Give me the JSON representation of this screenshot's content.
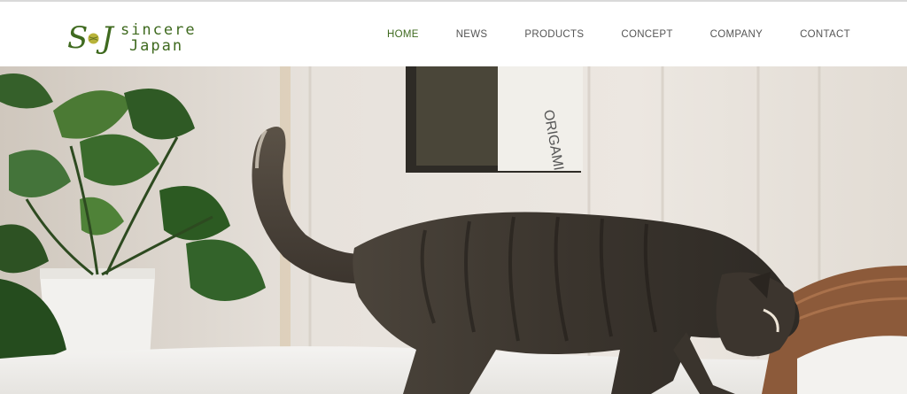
{
  "brand": {
    "mark_left": "S",
    "mark_right": "J",
    "word1": "sincere",
    "word2": "Japan",
    "color": "#3f6a1f"
  },
  "nav": {
    "items": [
      {
        "label": "HOME",
        "active": true
      },
      {
        "label": "NEWS",
        "active": false
      },
      {
        "label": "PRODUCTS",
        "active": false
      },
      {
        "label": "CONCEPT",
        "active": false
      },
      {
        "label": "COMPANY",
        "active": false
      },
      {
        "label": "CONTACT",
        "active": false
      }
    ],
    "active_color": "#3f6a1f",
    "text_color": "#555555"
  },
  "hero": {
    "subject": "tabby cat walking on a bed beside a potted plant",
    "book_spine_text": "ORIGAMI"
  }
}
